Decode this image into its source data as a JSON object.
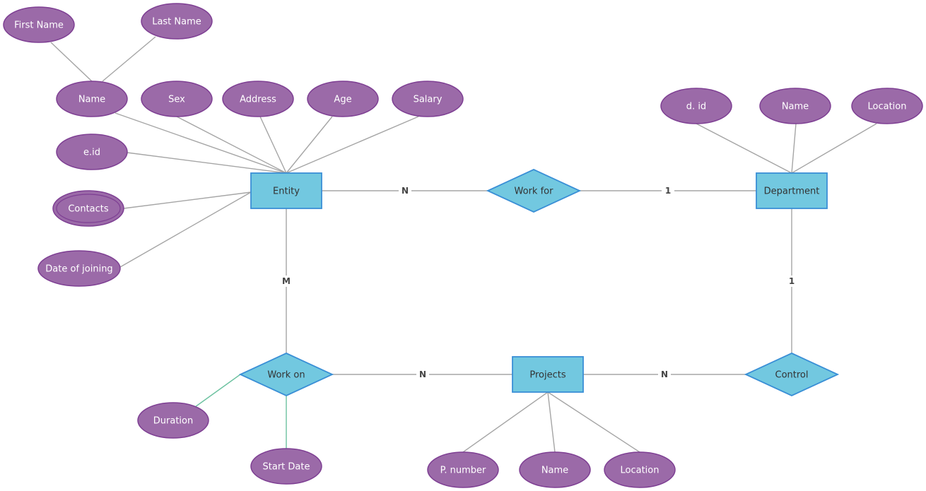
{
  "diagram": {
    "type": "er-diagram",
    "colors": {
      "attribute_fill": "#9b6aa8",
      "attribute_stroke": "#7e3f93",
      "entity_fill": "#72c8e0",
      "entity_stroke": "#3a8fd6",
      "edge": "#a5a5a5",
      "edge_attribute_of_relationship": "#6cc2a0"
    },
    "entities": [
      {
        "id": "entity",
        "label": "Entity"
      },
      {
        "id": "department",
        "label": "Department"
      },
      {
        "id": "projects",
        "label": "Projects"
      }
    ],
    "relationships": [
      {
        "id": "work_for",
        "label": "Work for"
      },
      {
        "id": "work_on",
        "label": "Work on"
      },
      {
        "id": "control",
        "label": "Control"
      }
    ],
    "attributes": [
      {
        "id": "first_name",
        "label": "First Name",
        "of": "name",
        "multivalued": false
      },
      {
        "id": "last_name",
        "label": "Last Name",
        "of": "name",
        "multivalued": false
      },
      {
        "id": "name",
        "label": "Name",
        "of": "entity",
        "multivalued": false
      },
      {
        "id": "sex",
        "label": "Sex",
        "of": "entity",
        "multivalued": false
      },
      {
        "id": "address",
        "label": "Address",
        "of": "entity",
        "multivalued": false
      },
      {
        "id": "age",
        "label": "Age",
        "of": "entity",
        "multivalued": false
      },
      {
        "id": "salary",
        "label": "Salary",
        "of": "entity",
        "multivalued": false
      },
      {
        "id": "eid",
        "label": "e.id",
        "of": "entity",
        "multivalued": false
      },
      {
        "id": "contacts",
        "label": "Contacts",
        "of": "entity",
        "multivalued": true
      },
      {
        "id": "date_joining",
        "label": "Date of joining",
        "of": "entity",
        "multivalued": false
      },
      {
        "id": "did",
        "label": "d. id",
        "of": "department",
        "multivalued": false
      },
      {
        "id": "dname",
        "label": "Name",
        "of": "department",
        "multivalued": false
      },
      {
        "id": "dlocation",
        "label": "Location",
        "of": "department",
        "multivalued": false
      },
      {
        "id": "duration",
        "label": "Duration",
        "of": "work_on",
        "multivalued": false
      },
      {
        "id": "start_date",
        "label": "Start Date",
        "of": "work_on",
        "multivalued": false
      },
      {
        "id": "pnumber",
        "label": "P. number",
        "of": "projects",
        "multivalued": false
      },
      {
        "id": "pname",
        "label": "Name",
        "of": "projects",
        "multivalued": false
      },
      {
        "id": "plocation",
        "label": "Location",
        "of": "projects",
        "multivalued": false
      }
    ],
    "links": [
      {
        "from": "entity",
        "to": "work_for",
        "cardinality": "N"
      },
      {
        "from": "work_for",
        "to": "department",
        "cardinality": "1"
      },
      {
        "from": "entity",
        "to": "work_on",
        "cardinality": "M"
      },
      {
        "from": "work_on",
        "to": "projects",
        "cardinality": "N"
      },
      {
        "from": "projects",
        "to": "control",
        "cardinality": "N"
      },
      {
        "from": "control",
        "to": "department",
        "cardinality": "1"
      }
    ]
  }
}
